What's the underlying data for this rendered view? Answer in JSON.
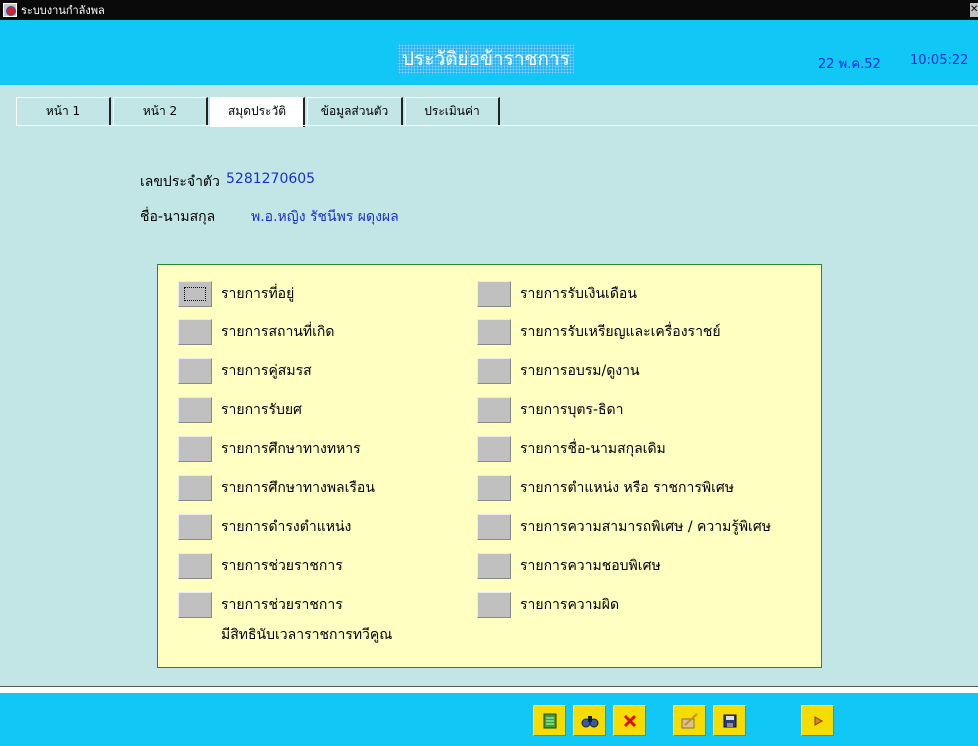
{
  "window": {
    "title": "ระบบงานกำลังพล"
  },
  "header": {
    "title": "ประวัติย่อข้าราชการ",
    "date": "22 พ.ค.52",
    "time": "10:05:22"
  },
  "tabs": [
    {
      "label": "หน้า 1"
    },
    {
      "label": "หน้า 2"
    },
    {
      "label": "สมุดประวัติ"
    },
    {
      "label": "ข้อมูลส่วนตัว"
    },
    {
      "label": "ประเมินค่า"
    }
  ],
  "active_tab": "สมุดประวัติ",
  "person": {
    "id_label": "เลขประจำตัว",
    "id_value": "5281270605",
    "name_label": "ชื่อ-นามสกุล",
    "name_value": "พ.อ.หญิง รัชนีพร ผดุงผล"
  },
  "records_left": [
    {
      "label": "รายการที่อยู่"
    },
    {
      "label": "รายการสถานที่เกิด"
    },
    {
      "label": "รายการคู่สมรส"
    },
    {
      "label": "รายการรับยศ"
    },
    {
      "label": "รายการศึกษาทางทหาร"
    },
    {
      "label": "รายการศึกษาทางพลเรือน"
    },
    {
      "label": "รายการดำรงตำแหน่ง"
    },
    {
      "label": "รายการช่วยราชการ"
    },
    {
      "label": "รายการช่วยราชการ",
      "label2": "มีสิทธินับเวลาราชการทวีคูณ"
    }
  ],
  "records_right": [
    {
      "label": "รายการรับเงินเดือน"
    },
    {
      "label": "รายการรับเหรียญและเครื่องราชย์"
    },
    {
      "label": "รายการอบรม/ดูงาน"
    },
    {
      "label": "รายการบุตร-ธิดา"
    },
    {
      "label": "รายการชื่อ-นามสกุลเดิม"
    },
    {
      "label": "รายการตำแหน่ง หรือ ราชการพิเศษ"
    },
    {
      "label": "รายการความสามารถพิเศษ / ความรู้พิเศษ"
    },
    {
      "label": "รายการความชอบพิเศษ"
    },
    {
      "label": "รายการความผิด"
    }
  ],
  "toolbar": [
    {
      "icon": "list-icon"
    },
    {
      "icon": "binoculars-icon"
    },
    {
      "icon": "delete-icon"
    },
    {
      "icon": "edit-icon"
    },
    {
      "icon": "save-icon"
    },
    {
      "icon": "next-icon"
    }
  ],
  "colors": {
    "header_bg": "#11c7f6",
    "main_bg": "#c2e6e6",
    "panel_bg": "#ffffc2",
    "value_text": "#1a2fd0",
    "toolbar_button": "#f6dc00"
  }
}
